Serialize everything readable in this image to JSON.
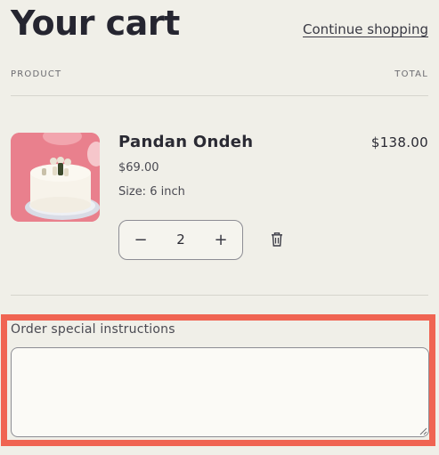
{
  "header": {
    "title": "Your cart",
    "continue_label": "Continue shopping"
  },
  "table": {
    "product_header": "PRODUCT",
    "total_header": "TOTAL"
  },
  "item": {
    "name": "Pandan Ondeh",
    "price": "$69.00",
    "variant": "Size: 6 inch",
    "line_total": "$138.00",
    "quantity": "2",
    "decrease_symbol": "−",
    "increase_symbol": "+",
    "image_alt": "Pandan Ondeh cake"
  },
  "instructions": {
    "label": "Order special instructions",
    "value": ""
  },
  "icons": {
    "minus": "minus-icon",
    "plus": "plus-icon",
    "trash": "trash-icon",
    "resize": "resize-grip-icon"
  },
  "colors": {
    "background": "#f0efe8",
    "text": "#2a2a33",
    "highlight": "#f06452",
    "image_bg": "#e9808d"
  }
}
